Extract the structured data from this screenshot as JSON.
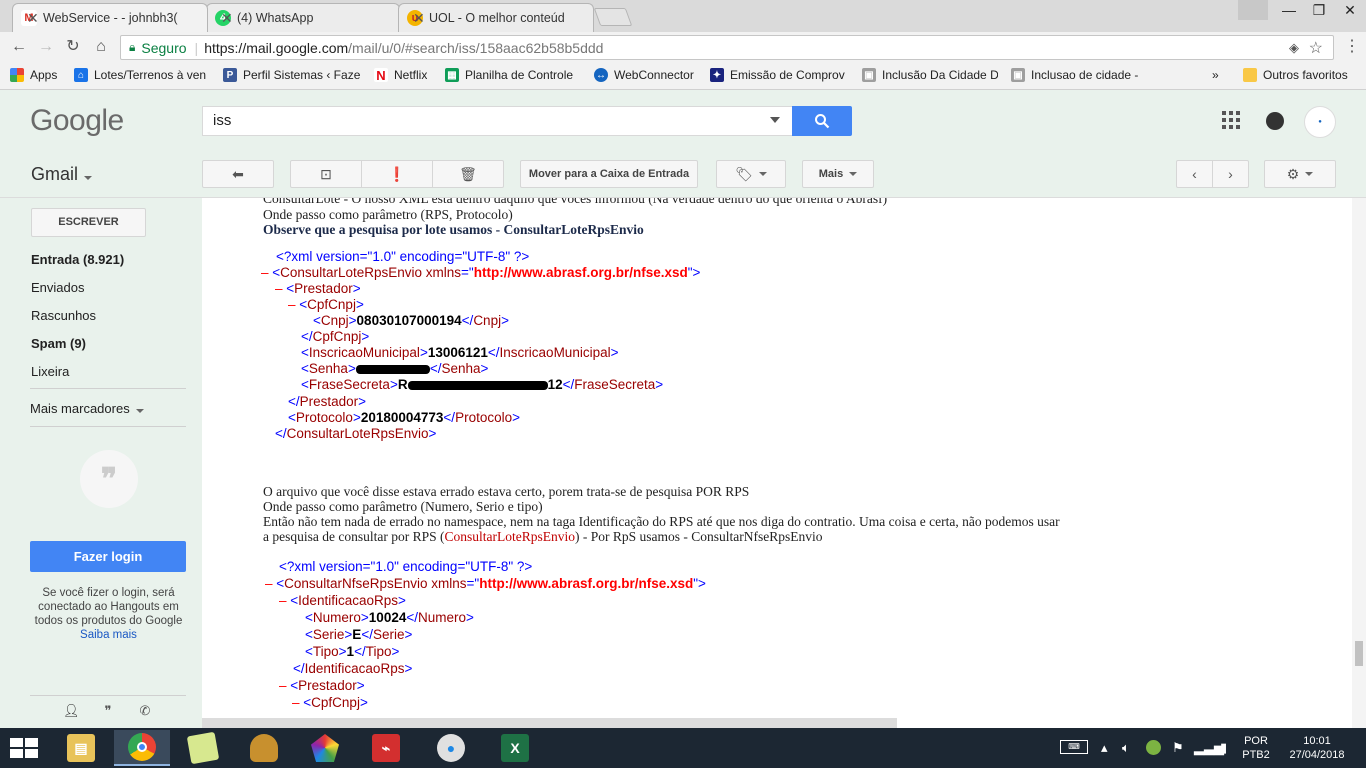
{
  "browser": {
    "tabs": [
      {
        "title": "WebService - - johnbh3(",
        "icon": "gmail-icon",
        "active": true
      },
      {
        "title": "(4) WhatsApp",
        "icon": "whatsapp-icon",
        "active": false
      },
      {
        "title": "UOL - O melhor conteúd",
        "icon": "uol-icon",
        "active": false
      }
    ],
    "secure_label": "Seguro",
    "url_host": "https://mail.google.com",
    "url_rest": "/mail/u/0/#search/iss/158aac62b58b5ddd",
    "bookmarks": [
      {
        "label": "Apps",
        "icon": "apps-grid-icon"
      },
      {
        "label": "Lotes/Terrenos à ven",
        "icon": "home-icon"
      },
      {
        "label": "Perfil Sistemas ‹ Faze",
        "icon": "perfil-icon"
      },
      {
        "label": "Netflix",
        "icon": "netflix-icon"
      },
      {
        "label": "Planilha de Controle",
        "icon": "sheets-icon"
      },
      {
        "label": "WebConnector",
        "icon": "webconnector-icon"
      },
      {
        "label": "Emissão de Comprov",
        "icon": "receita-icon"
      },
      {
        "label": "Inclusão Da Cidade D",
        "icon": "image-icon"
      },
      {
        "label": "Inclusao de cidade -",
        "icon": "image-icon"
      },
      {
        "label": "Outros favoritos",
        "icon": "folder-icon"
      }
    ]
  },
  "gmail": {
    "logo": "Google",
    "search_value": "iss",
    "label": "Gmail",
    "actions": {
      "move_inbox": "Mover para a Caixa de Entrada",
      "more": "Mais"
    },
    "sidebar": {
      "compose": "ESCREVER",
      "items": [
        {
          "label": "Entrada (8.921)",
          "bold": true
        },
        {
          "label": "Enviados",
          "bold": false
        },
        {
          "label": "Rascunhos",
          "bold": false
        },
        {
          "label": "Spam (9)",
          "bold": true
        },
        {
          "label": "Lixeira",
          "bold": false
        }
      ],
      "more_labels": "Mais marcadores",
      "login_button": "Fazer login",
      "login_text": "Se você fizer o login, será conectado ao Hangouts em todos os produtos do Google",
      "learn_more": "Saiba mais"
    }
  },
  "message": {
    "line_top": "ConsultarLote - O nosso XML está dentro daquilo que vocês informou (Na verdade dentro do que orienta o Abrasf)",
    "line_params1": "Onde passo como parâmetro (RPS, Protocolo)",
    "line_bold": "Observe que a pesquisa por lote usamos - ConsultarLoteRpsEnvio",
    "xml1": {
      "pi": "<?xml version=\"1.0\" encoding=\"UTF-8\" ?>",
      "root": "ConsultarLoteRpsEnvio",
      "xmlns_attr": "xmlns",
      "xmlns": "http://www.abrasf.org.br/nfse.xsd",
      "prestador": "Prestador",
      "cpfcnpj": "CpfCnpj",
      "cnpj_tag": "Cnpj",
      "cnpj": "08030107000194",
      "im_tag": "InscricaoMunicipal",
      "im": "13006121",
      "senha_tag": "Senha",
      "frase_tag": "FraseSecreta",
      "frase_prefix": "R",
      "frase_suffix": "12",
      "protocolo_tag": "Protocolo",
      "protocolo": "20180004773"
    },
    "para1": "O arquivo que você disse estava errado estava certo, porem trata-se de pesquisa POR RPS",
    "para2": "Onde passo como parâmetro (Numero, Serio e tipo)",
    "para3": "Então não tem nada de errado no namespace, nem na taga Identificação do RPS até que nos diga do contratio. Uma coisa e certa, não podemos usar",
    "para4_a": "a pesquisa de consultar por RPS (",
    "para4_link": "ConsultarLoteRpsEnvio",
    "para4_b": ") - Por RpS usamos  - ConsultarNfseRpsEnvio",
    "xml2": {
      "pi": "<?xml version=\"1.0\" encoding=\"UTF-8\" ?>",
      "root": "ConsultarNfseRpsEnvio",
      "xmlns_attr": "xmlns",
      "xmlns": "http://www.abrasf.org.br/nfse.xsd",
      "ident": "IdentificacaoRps",
      "numero_tag": "Numero",
      "numero": "10024",
      "serie_tag": "Serie",
      "serie": "E",
      "tipo_tag": "Tipo",
      "tipo": "1",
      "prestador": "Prestador",
      "cpfcnpj": "CpfCnpj"
    }
  },
  "taskbar": {
    "lang_top": "POR",
    "lang_bottom": "PTB2",
    "time": "10:01",
    "date": "27/04/2018"
  },
  "colors": {
    "gmail_bg": "#e9f2ec",
    "search_blue": "#4285f4",
    "xml_tag": "#990000",
    "xml_bracket": "#0000ff",
    "xml_value_url": "#ff0000",
    "taskbar": "#1c2733"
  }
}
